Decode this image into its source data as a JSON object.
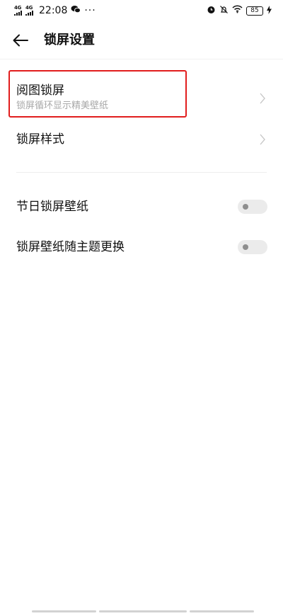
{
  "status_bar": {
    "sim1_label": "4G",
    "sim2_label": "4G",
    "time": "22:08",
    "overflow": "···",
    "battery": "85",
    "icons": [
      "signal-icon",
      "wechat-icon",
      "alarm-icon",
      "mute-icon",
      "wifi-icon",
      "battery-icon",
      "charging-icon"
    ]
  },
  "header": {
    "title": "锁屏设置",
    "back_icon": "back-arrow-icon"
  },
  "items": [
    {
      "title": "阅图锁屏",
      "subtitle": "锁屏循环显示精美壁纸",
      "control": "chevron",
      "highlighted": true
    },
    {
      "title": "锁屏样式",
      "control": "chevron"
    },
    {
      "title": "节日锁屏壁纸",
      "control": "toggle",
      "on": false
    },
    {
      "title": "锁屏壁纸随主题更换",
      "control": "toggle",
      "on": false
    }
  ],
  "colors": {
    "highlight_border": "#e11d1d",
    "subtitle": "#a8a8a8",
    "toggle_track": "#ebebeb"
  }
}
